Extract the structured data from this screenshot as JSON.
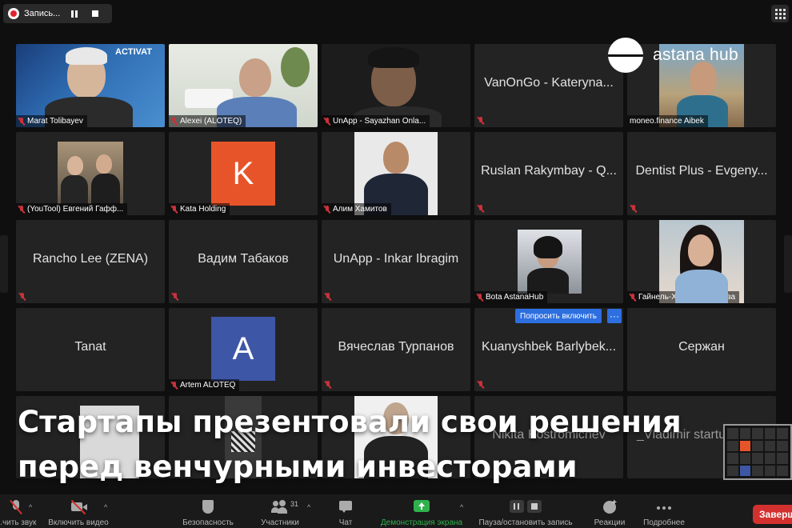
{
  "recording": {
    "label": "Запись..."
  },
  "logo": {
    "text": "astana hub"
  },
  "headline": {
    "line1": "Стартапы презентовали свои решения",
    "line2": "перед венчурными инвесторами"
  },
  "tiles": {
    "r1": [
      "Marat Tolibayev",
      "Alexei (ALOTEQ)",
      "UnApp - Sayazhan Onla...",
      "VanOnGo - Kateryna...",
      "moneo.finance Aibek"
    ],
    "r1_watermark": "ACTIVAT",
    "r2": [
      "(YouTool) Евгений Гафф...",
      "Kata Holding",
      "Алим Хамитов",
      "Ruslan Rakymbay - Q...",
      "Dentist Plus - Evgeny..."
    ],
    "r2_avatar_letter": "K",
    "r3": [
      "Rancho Lee (ZENA)",
      "Вадим Табаков",
      "UnApp - Inkar Ibragim",
      "Bota AstanaHub",
      "Гайнель-Хаят Машрапова"
    ],
    "r4": [
      "Tanat",
      "Artem ALOTEQ",
      "Вячеслав Турпанов",
      "Kuanyshbek Barlybek...",
      "Сержан"
    ],
    "r4_avatar_letter": "A",
    "r5": [
      "Nikita Kostromichev",
      "_Vladimir startu"
    ],
    "ask_button": "Попросить включить",
    "more_button": "···"
  },
  "toolbar": {
    "mute": "...чить звук",
    "video": "Включить видео",
    "security": "Безопасность",
    "participants": "Участники",
    "participants_count": "31",
    "chat": "Чат",
    "share": "Демонстрация экрана",
    "pause_record": "Пауза/остановить запись",
    "reactions": "Реакции",
    "more": "Подробнее",
    "end": "Заверш"
  },
  "colors": {
    "accent_green": "#2fb24c",
    "end_red": "#d3312f",
    "ask_blue": "#2d6fe0",
    "avatar_orange": "#e8542a",
    "avatar_blue": "#3e56a6"
  }
}
